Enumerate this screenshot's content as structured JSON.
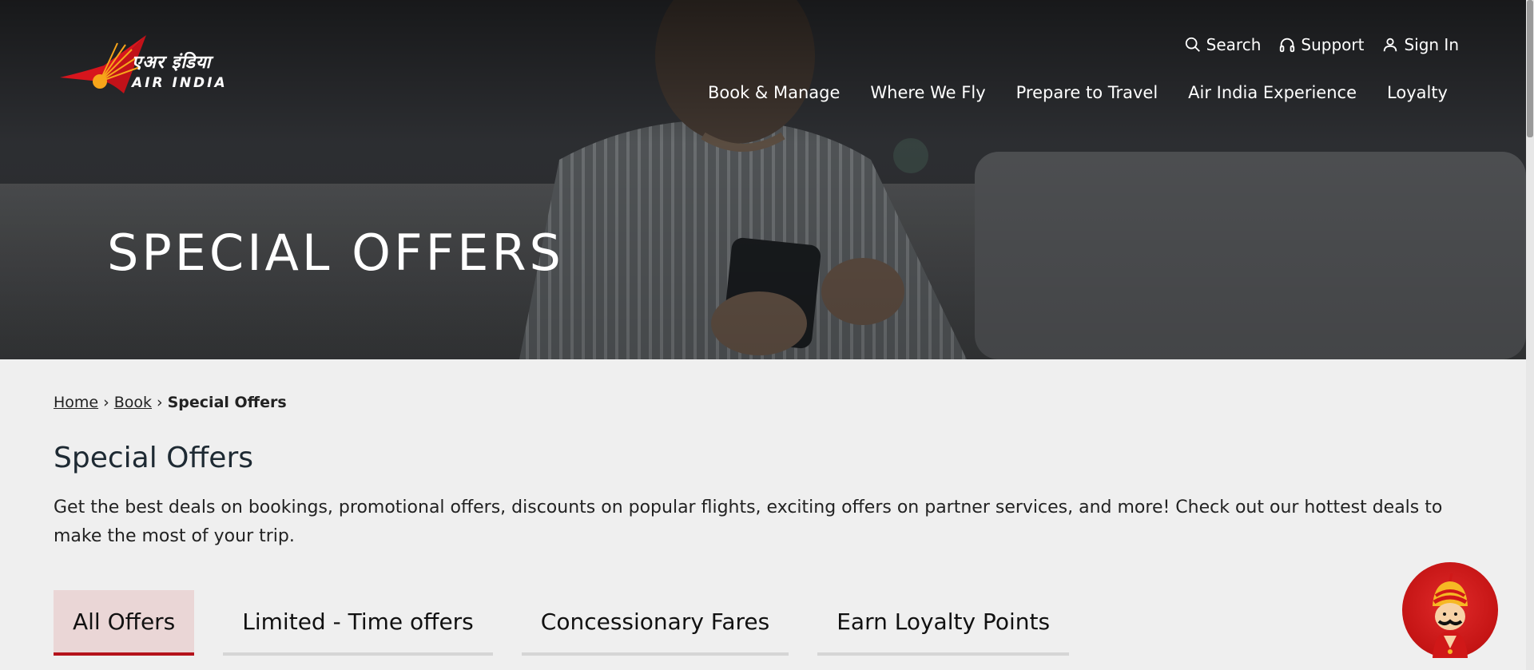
{
  "header": {
    "logo_hindi": "एअर इंडिया",
    "logo_english": "AIR INDIA",
    "utility_nav": [
      {
        "label": "Search",
        "icon": "search-icon"
      },
      {
        "label": "Support",
        "icon": "headset-icon"
      },
      {
        "label": "Sign In",
        "icon": "user-icon"
      }
    ],
    "main_nav": [
      "Book & Manage",
      "Where We Fly",
      "Prepare to Travel",
      "Air India Experience",
      "Loyalty"
    ]
  },
  "hero": {
    "title": "SPECIAL OFFERS"
  },
  "breadcrumb": {
    "items": [
      {
        "label": "Home"
      },
      {
        "label": "Book"
      }
    ],
    "separator": "›",
    "current": "Special Offers"
  },
  "main": {
    "title": "Special Offers",
    "description": "Get the best deals on bookings, promotional offers, discounts on popular flights, exciting offers on partner services, and more! Check out our hottest deals to make the most of your trip.",
    "tabs": [
      {
        "label": "All Offers",
        "active": true
      },
      {
        "label": "Limited - Time offers",
        "active": false
      },
      {
        "label": "Concessionary Fares",
        "active": false
      },
      {
        "label": "Earn Loyalty Points",
        "active": false
      }
    ]
  },
  "colors": {
    "brand_red": "#b5121b",
    "active_tab_bg": "#ead6d6",
    "page_bg": "#efefef"
  },
  "chat_assistant": {
    "icon": "maharaja-mascot-icon"
  }
}
